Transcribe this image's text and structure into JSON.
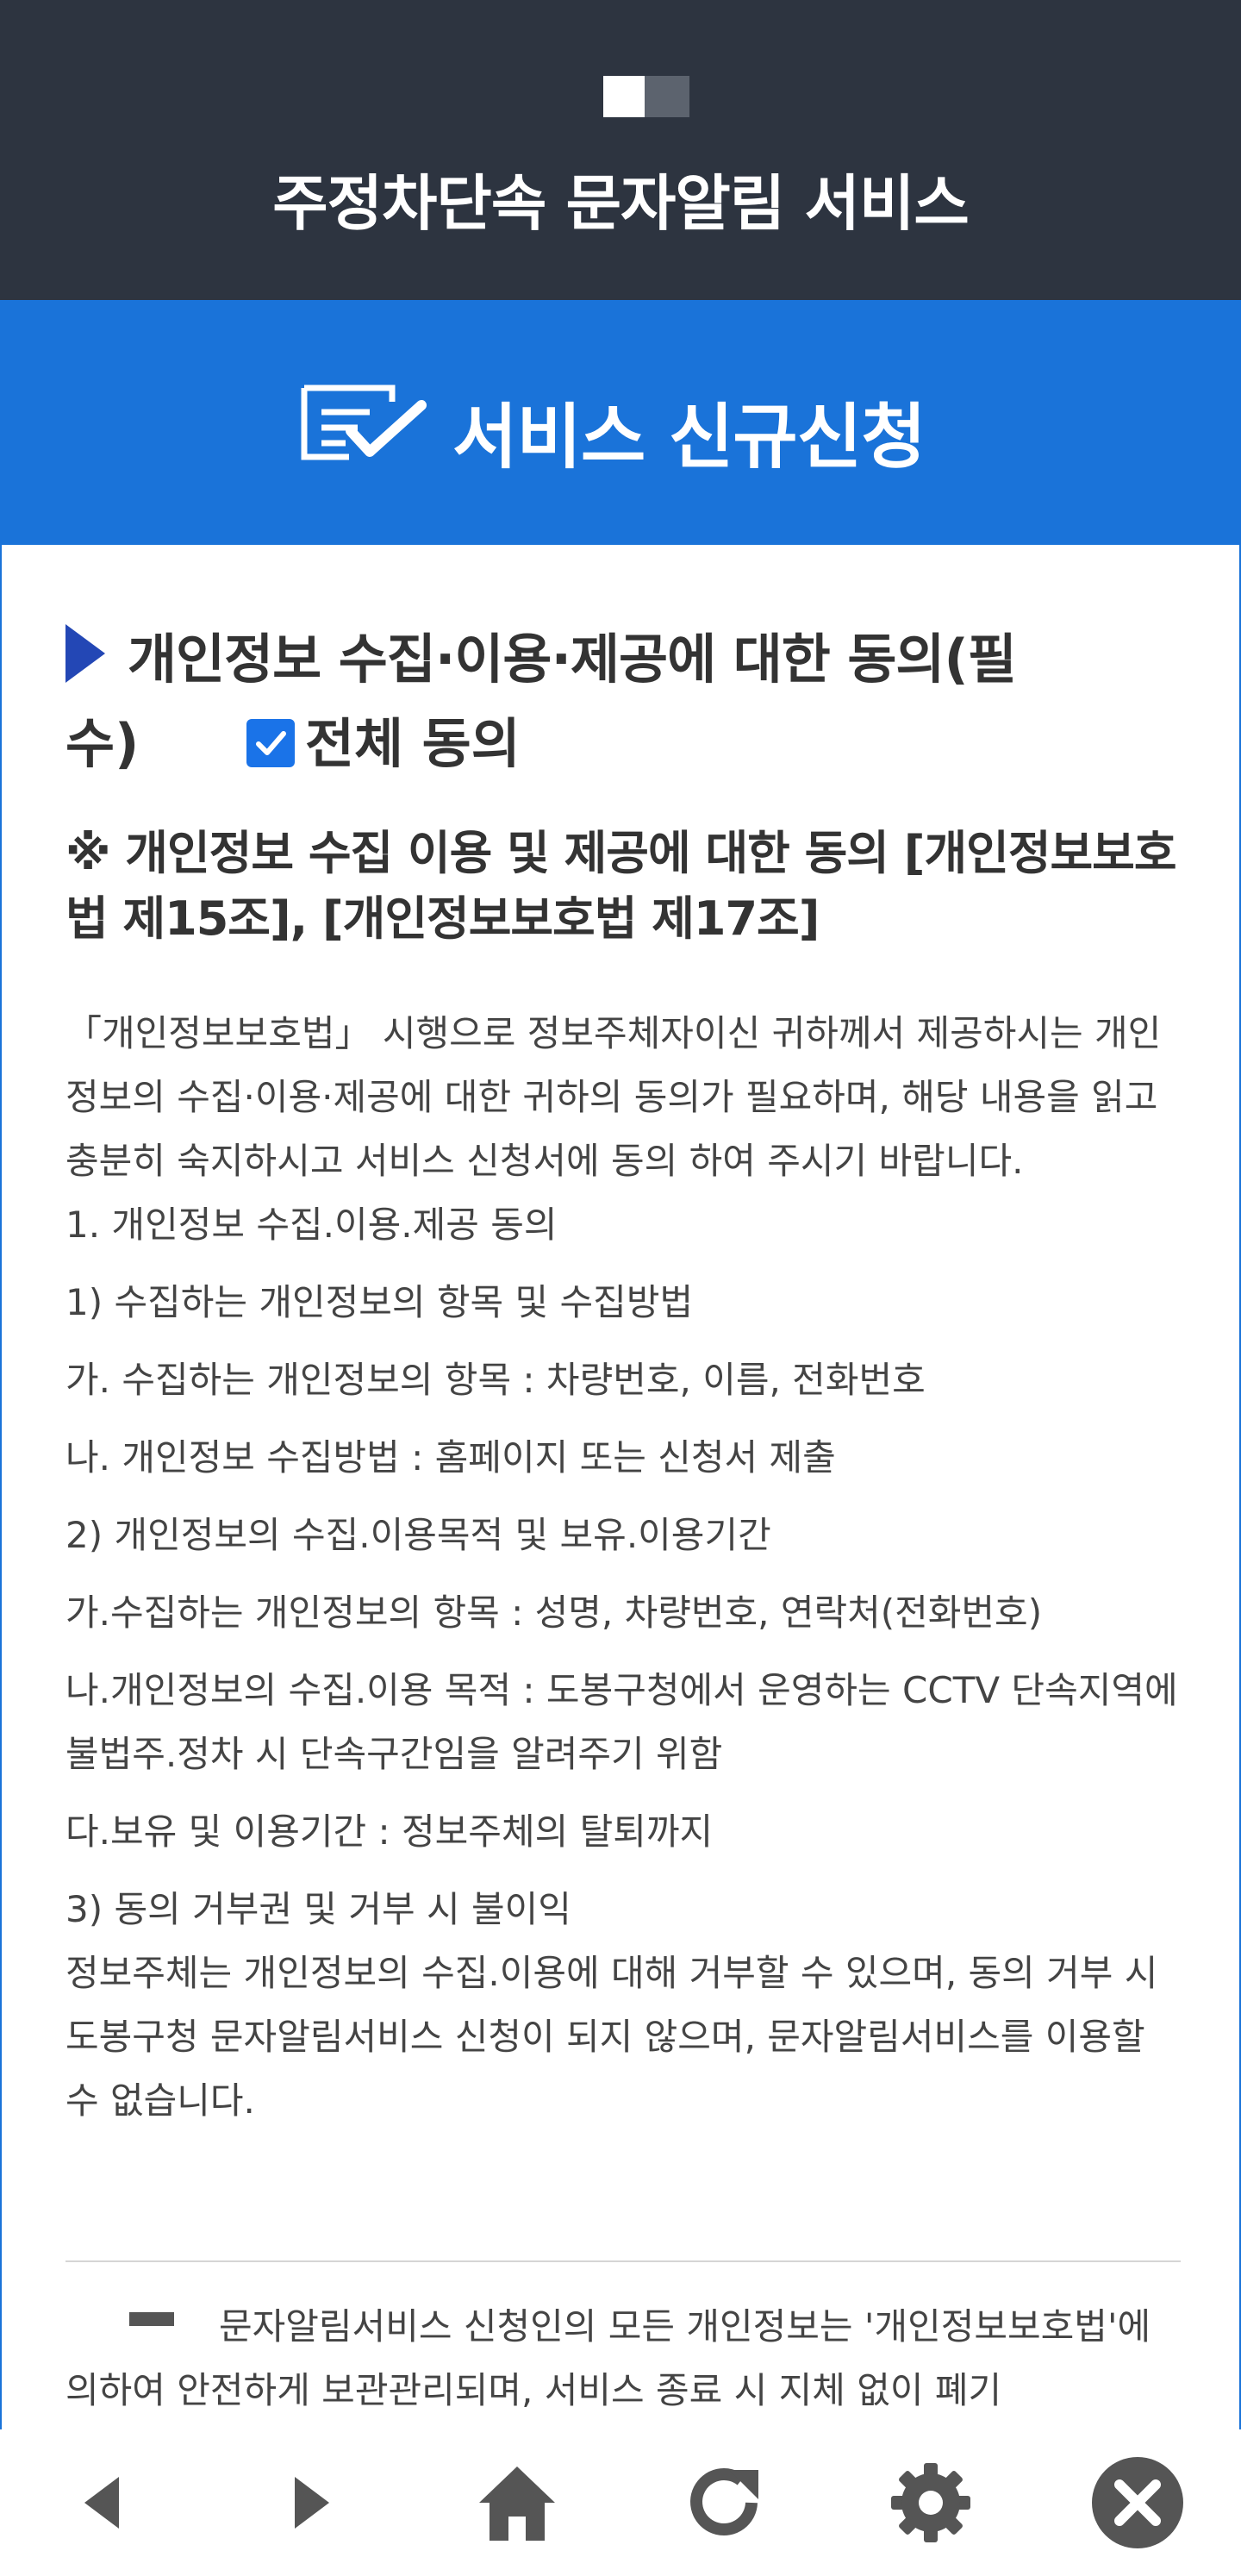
{
  "header": {
    "title": "주정차단속 문자알림 서비스"
  },
  "banner": {
    "title": "서비스 신규신청"
  },
  "consent": {
    "heading_line1": "개인정보 수집·이용·제공에 대한 동의(필",
    "heading_line2": "수)",
    "agree_all_label": "전체 동의",
    "agree_all_checked": true,
    "notice_title": "※ 개인정보 수집 이용 및 제공에 대한 동의 [개인정보보호법 제15조], [개인정보보호법 제17조]",
    "intro": "「개인정보보호법」 시행으로 정보주체자이신 귀하께서 제공하시는 개인정보의 수집·이용·제공에 대한 귀하의 동의가 필요하며, 해당 내용을 읽고 충분히 숙지하시고 서비스 신청서에 동의 하여 주시기 바랍니다.",
    "items": [
      "1. 개인정보 수집.이용.제공 동의",
      " 1) 수집하는 개인정보의 항목 및 수집방법",
      "  가. 수집하는 개인정보의 항목 : 차량번호, 이름, 전화번호",
      "  나. 개인정보 수집방법 : 홈페이지 또는 신청서 제출",
      " 2) 개인정보의 수집.이용목적 및 보유.이용기간",
      "  가.수집하는 개인정보의 항목 : 성명, 차량번호, 연락처(전화번호)",
      "  나.개인정보의 수집.이용 목적 : 도봉구청에서 운영하는 CCTV 단속지역에 불법주.정차 시 단속구간임을 알려주기 위함",
      "  다.보유 및 이용기간 : 정보주체의 탈퇴까지",
      " 3) 동의 거부권 및 거부 시 불이익",
      "  정보주체는 개인정보의 수집.이용에 대해 거부할 수 있으며, 동의 거부 시 도봉구청 문자알림서비스 신청이 되지 않으며, 문자알림서비스를 이용할 수 없습니다."
    ],
    "footer_note": "문자알림서비스 신청인의 모든 개인정보는 '개인정보보호법'에 의하여 안전하게 보관관리되며, 서비스 종료 시 지체 없이 폐기"
  },
  "nav": {
    "icons": [
      "back-icon",
      "forward-icon",
      "home-icon",
      "refresh-icon",
      "settings-icon",
      "close-icon"
    ]
  },
  "colors": {
    "header_bg": "#2d3440",
    "accent_blue": "#1a73d9",
    "marker": "#2347b5"
  }
}
